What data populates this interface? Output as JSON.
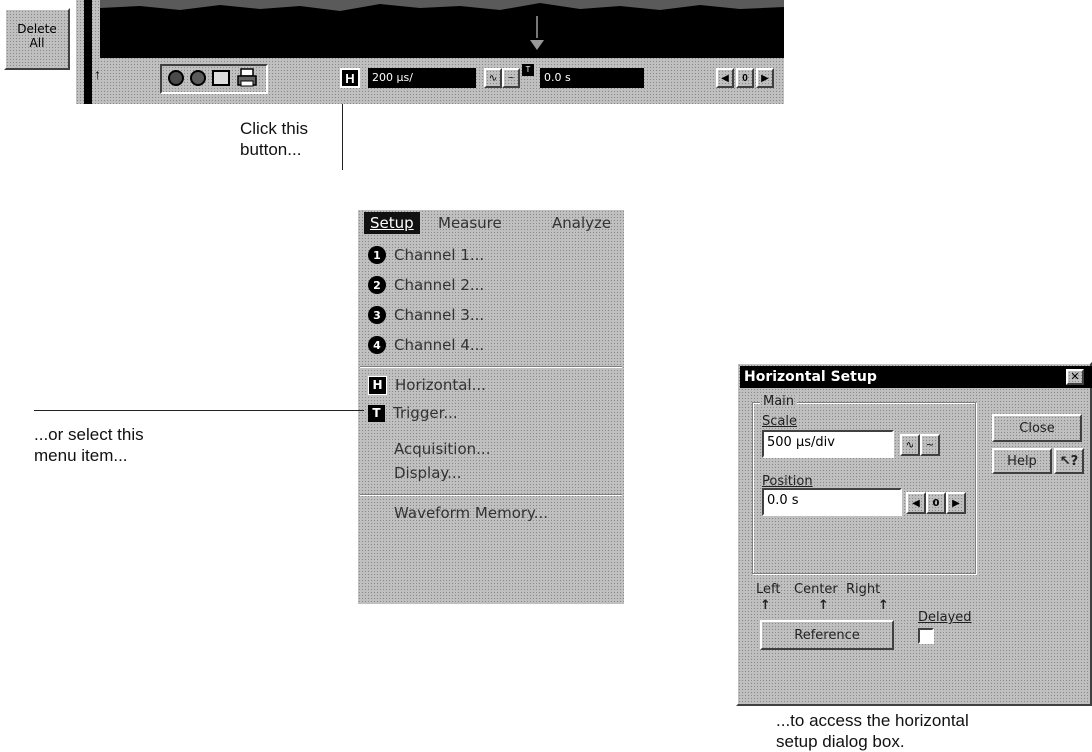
{
  "toolbar": {
    "delete_all": [
      "Delete",
      "All"
    ],
    "timebase_value": "200 µs/",
    "delay_value": "0.0 s",
    "h_icon": "H",
    "zero_label": "0",
    "icons": [
      "ref-arrow-icon",
      "stop-icon",
      "run-icon",
      "copy-icon",
      "print-icon",
      "slope-icons",
      "trigger-icon"
    ]
  },
  "captions": {
    "click": [
      "Click this",
      "button..."
    ],
    "select": [
      "...or select this",
      "menu item..."
    ],
    "access": [
      "...to access the horizontal",
      "setup dialog box."
    ]
  },
  "menu": {
    "bar": [
      "Setup",
      "Measure",
      "Analyze"
    ],
    "channels": [
      {
        "num": "1",
        "label": "Channel 1..."
      },
      {
        "num": "2",
        "label": "Channel 2..."
      },
      {
        "num": "3",
        "label": "Channel 3..."
      },
      {
        "num": "4",
        "label": "Channel 4..."
      }
    ],
    "horizontal": {
      "icon": "H",
      "label": "Horizontal..."
    },
    "trigger": {
      "icon": "T",
      "label": "Trigger..."
    },
    "acquisition": "Acquisition...",
    "display": "Display...",
    "waveform_memory": "Waveform Memory..."
  },
  "dialog": {
    "title": "Horizontal Setup",
    "group": "Main",
    "scale_label": "Scale",
    "scale_value": "500 µs/div",
    "position_label": "Position",
    "position_value": "0.0 s",
    "zero_label": "0",
    "close_button": "Close",
    "help_button": "Help",
    "ref_labels": [
      "Left",
      "Center",
      "Right"
    ],
    "reference_button": "Reference",
    "delayed_label": "Delayed"
  }
}
